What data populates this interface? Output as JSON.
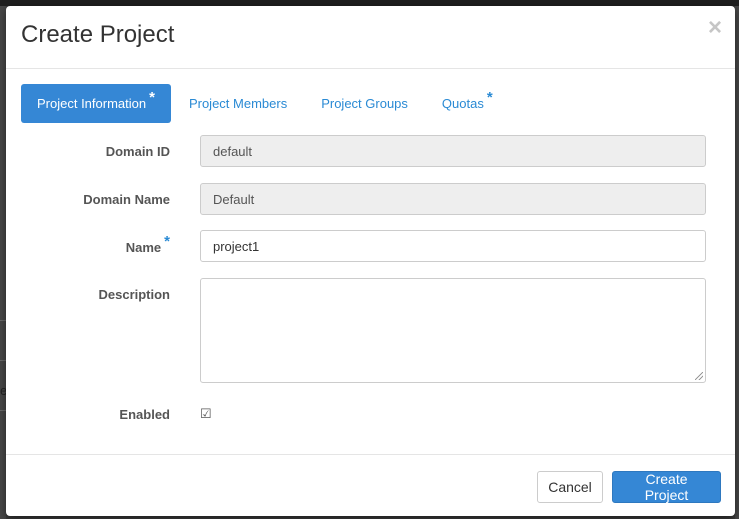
{
  "modal": {
    "title": "Create Project",
    "close_glyph": "×"
  },
  "tabs": [
    {
      "label": "Project Information",
      "required": "*",
      "active": true
    },
    {
      "label": "Project Members",
      "required": "",
      "active": false
    },
    {
      "label": "Project Groups",
      "required": "",
      "active": false
    },
    {
      "label": "Quotas",
      "required": "*",
      "active": false
    }
  ],
  "form": {
    "domain_id": {
      "label": "Domain ID",
      "value": "default"
    },
    "domain_name": {
      "label": "Domain Name",
      "value": "Default"
    },
    "name": {
      "label": "Name",
      "required": "*",
      "value": "project1"
    },
    "description": {
      "label": "Description",
      "value": ""
    },
    "enabled": {
      "label": "Enabled",
      "checked": true,
      "glyph": "☑"
    }
  },
  "footer": {
    "cancel_label": "Cancel",
    "submit_label": "Create Project"
  },
  "background": {
    "fragment_text": "e"
  },
  "colors": {
    "primary": "#3587d5",
    "link": "#2a8ad4"
  }
}
